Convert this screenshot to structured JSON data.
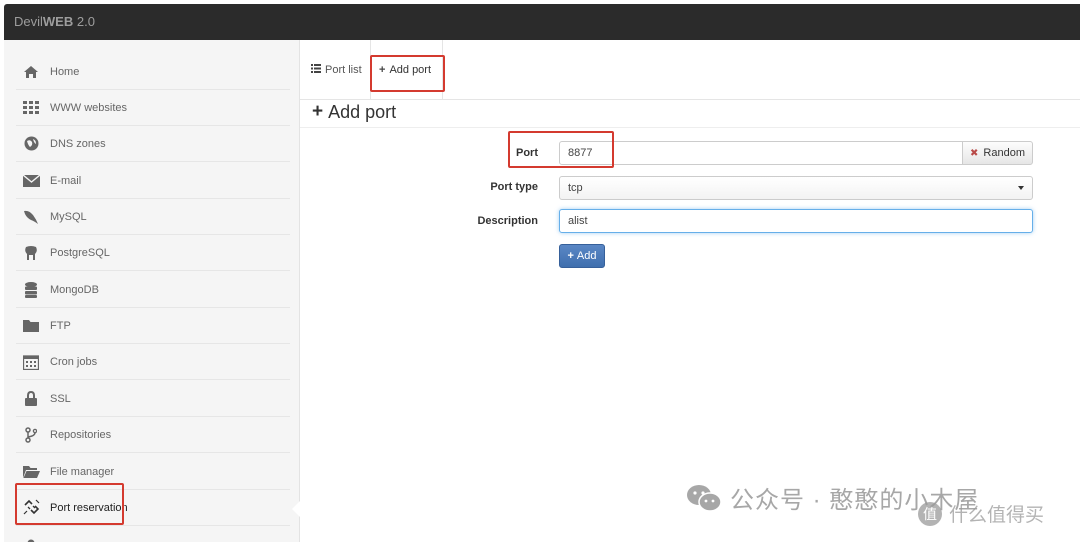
{
  "app": {
    "title_prefix": "Devil",
    "title_bold": "WEB",
    "title_suffix": " 2.0"
  },
  "sidebar": {
    "items": [
      {
        "label": "Home",
        "icon": "home-icon"
      },
      {
        "label": "WWW websites",
        "icon": "grid-icon"
      },
      {
        "label": "DNS zones",
        "icon": "globe-icon"
      },
      {
        "label": "E-mail",
        "icon": "envelope-icon"
      },
      {
        "label": "MySQL",
        "icon": "dolphin-icon"
      },
      {
        "label": "PostgreSQL",
        "icon": "elephant-icon"
      },
      {
        "label": "MongoDB",
        "icon": "database-icon"
      },
      {
        "label": "FTP",
        "icon": "folder-icon"
      },
      {
        "label": "Cron jobs",
        "icon": "calendar-icon"
      },
      {
        "label": "SSL",
        "icon": "lock-icon"
      },
      {
        "label": "Repositories",
        "icon": "branch-icon"
      },
      {
        "label": "File manager",
        "icon": "folder-open-icon"
      },
      {
        "label": "Port reservation",
        "icon": "link-icon"
      }
    ],
    "active": "Port reservation"
  },
  "tabs": {
    "list_label": "Port list",
    "add_label": "Add port",
    "active": "Add port"
  },
  "form": {
    "title": "Add port",
    "port_label": "Port",
    "port_value": "8877",
    "random_label": "Random",
    "type_label": "Port type",
    "type_value": "tcp",
    "description_label": "Description",
    "description_value": "alist",
    "submit_label": "Add"
  },
  "watermark": {
    "line1": "公众号 · 憨憨的小木屋",
    "line2": "什么值得买"
  },
  "colors": {
    "topbar": "#2b2b2b",
    "sidebar_bg": "#f5f5f5",
    "primary_button": "#4a7bbd",
    "annotation_red": "#d43a2f",
    "focus_border": "#66afe9"
  }
}
